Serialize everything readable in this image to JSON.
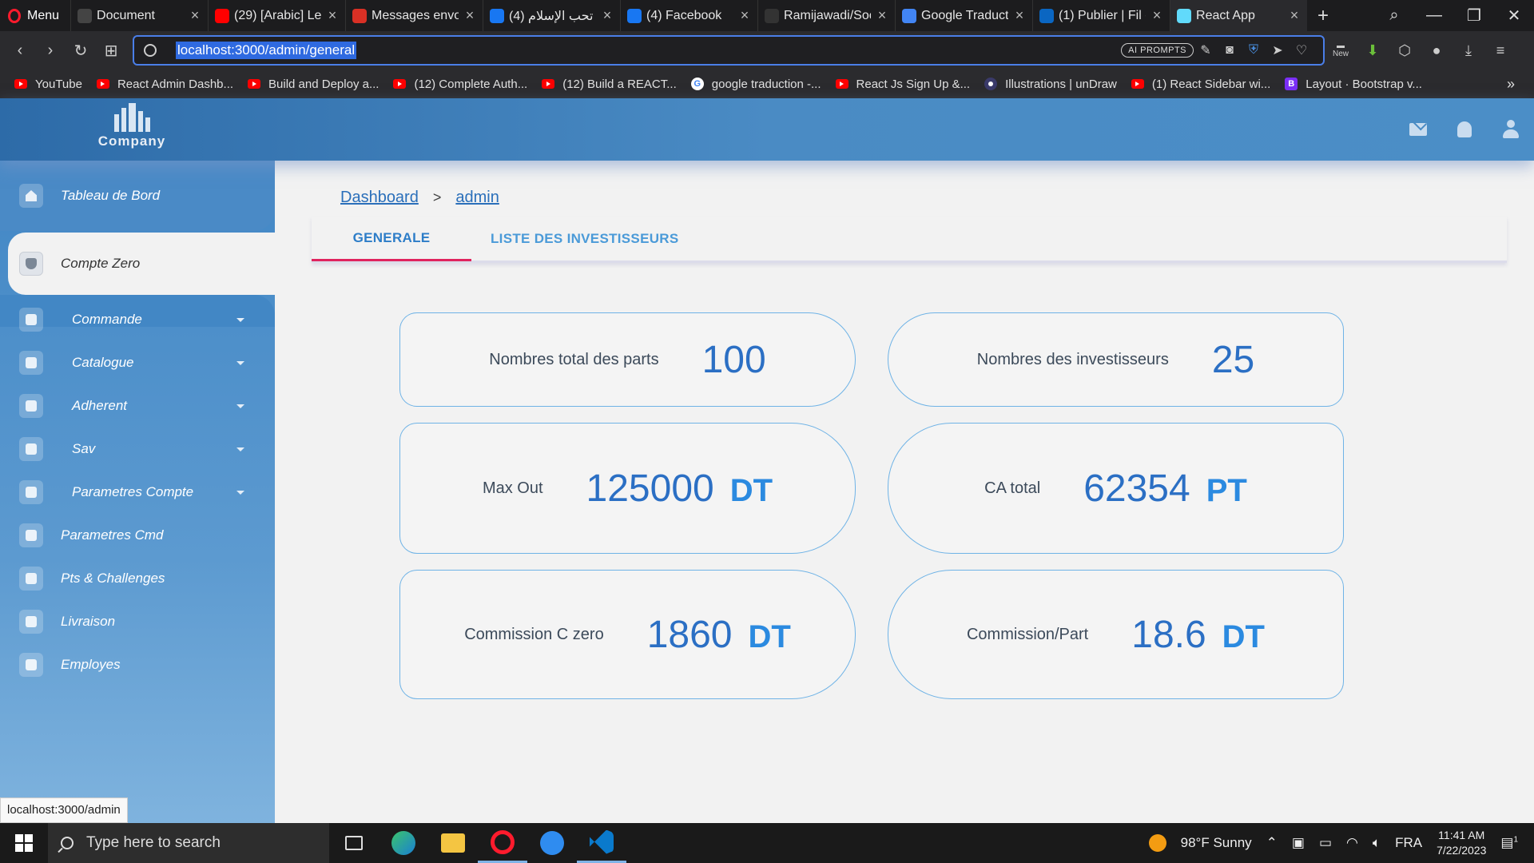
{
  "browser": {
    "menu_label": "Menu",
    "tabs": [
      {
        "title": "Document",
        "color": "#444"
      },
      {
        "title": "(29) [Arabic] Le",
        "color": "#ff0000"
      },
      {
        "title": "Messages envo",
        "color": "#d93025"
      },
      {
        "title": "(4) تحب الإسلام :",
        "color": "#1877f2"
      },
      {
        "title": "(4) Facebook",
        "color": "#1877f2"
      },
      {
        "title": "Ramijawadi/Soc",
        "color": "#333"
      },
      {
        "title": "Google Traducti",
        "color": "#4285f4"
      },
      {
        "title": "(1) Publier | Fil d",
        "color": "#0a66c2"
      },
      {
        "title": "React App",
        "color": "#61dafb"
      }
    ],
    "url": "localhost:3000/admin/general",
    "ai_prompts": "AI PROMPTS",
    "new_badge": "New",
    "bookmarks": [
      {
        "label": "YouTube",
        "icon": "youtube"
      },
      {
        "label": "React Admin Dashb...",
        "icon": "youtube"
      },
      {
        "label": "Build and Deploy a...",
        "icon": "youtube"
      },
      {
        "label": "(12) Complete Auth...",
        "icon": "youtube"
      },
      {
        "label": "(12) Build a REACT...",
        "icon": "youtube"
      },
      {
        "label": "google traduction -...",
        "icon": "google"
      },
      {
        "label": "React Js Sign Up &...",
        "icon": "youtube"
      },
      {
        "label": "Illustrations | unDraw",
        "icon": "undraw"
      },
      {
        "label": "(1) React Sidebar wi...",
        "icon": "youtube"
      },
      {
        "label": "Layout · Bootstrap v...",
        "icon": "bootstrap"
      }
    ]
  },
  "app": {
    "company": "Company",
    "breadcrumb": {
      "root": "Dashboard",
      "separator": ">",
      "current": "admin"
    },
    "tabs": {
      "general": "GENERALE",
      "investors": "LISTE DES INVESTISSEURS"
    },
    "sidebar": {
      "dashboard": "Tableau de Bord",
      "active": "Compte Zero",
      "items": [
        {
          "label": "Commande",
          "icon": "cart-icon",
          "dropdown": true
        },
        {
          "label": "Catalogue",
          "icon": "grid-icon",
          "dropdown": true
        },
        {
          "label": "Adherent",
          "icon": "user-icon",
          "dropdown": true
        },
        {
          "label": "Sav",
          "icon": "bulb-icon",
          "dropdown": true
        },
        {
          "label": "Parametres Compte",
          "icon": "gear-icon",
          "dropdown": true
        },
        {
          "label": "Parametres Cmd",
          "icon": "gears-icon",
          "dropdown": false
        },
        {
          "label": "Pts & Challenges",
          "icon": "trophy-icon",
          "dropdown": false
        },
        {
          "label": "Livraison",
          "icon": "truck-icon",
          "dropdown": false
        },
        {
          "label": "Employes",
          "icon": "people-icon",
          "dropdown": false
        }
      ]
    },
    "cards": {
      "total_parts": {
        "label": "Nombres total des parts",
        "value": "100"
      },
      "investors": {
        "label": "Nombres des investisseurs",
        "value": "25"
      },
      "max_out": {
        "label": "Max Out",
        "value": "125000",
        "unit": "DT"
      },
      "ca_total": {
        "label": "CA total",
        "value": "62354",
        "unit": "PT"
      },
      "commission": {
        "label": "Commission C zero",
        "value": "1860",
        "unit": "DT"
      },
      "commission_part": {
        "label": "Commission/Part",
        "value": "18.6",
        "unit": "DT"
      }
    },
    "status_url": "localhost:3000/admin"
  },
  "taskbar": {
    "search_placeholder": "Type here to search",
    "weather": "98°F  Sunny",
    "lang": "FRA",
    "time": "11:41 AM",
    "date": "7/22/2023",
    "notif_count": "1"
  }
}
